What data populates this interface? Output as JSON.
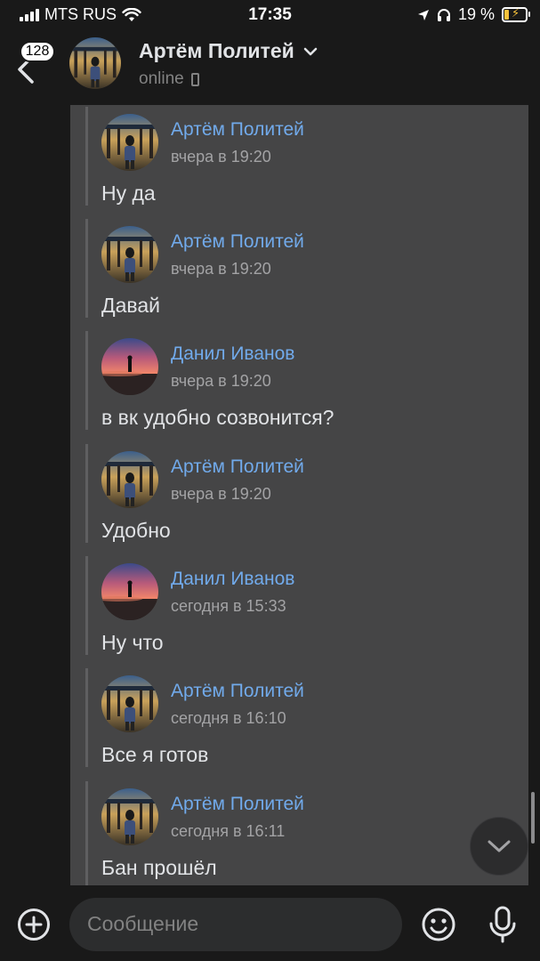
{
  "status_bar": {
    "carrier": "MTS RUS",
    "time": "17:35",
    "battery": "19 %"
  },
  "header": {
    "unread_count": "128",
    "name": "Артём Политей",
    "status": "online"
  },
  "messages": [
    {
      "author": "Артём Политей",
      "time": "вчера в 19:20",
      "text": "Ну да",
      "avatar": "artem-avatar"
    },
    {
      "author": "Артём Политей",
      "time": "вчера в 19:20",
      "text": "Давай",
      "avatar": "artem-avatar"
    },
    {
      "author": "Данил Иванов",
      "time": "вчера в 19:20",
      "text": "в вк удобно созвонится?",
      "avatar": "danil-avatar"
    },
    {
      "author": "Артём Политей",
      "time": "вчера в 19:20",
      "text": "Удобно",
      "avatar": "artem-avatar"
    },
    {
      "author": "Данил Иванов",
      "time": "сегодня в 15:33",
      "text": "Ну что",
      "avatar": "danil-avatar"
    },
    {
      "author": "Артём Политей",
      "time": "сегодня в 16:10",
      "text": "Все я готов",
      "avatar": "artem-avatar"
    },
    {
      "author": "Артём Политей",
      "time": "сегодня в 16:11",
      "text": "Бан прошёл",
      "avatar": "artem-avatar"
    }
  ],
  "composer": {
    "placeholder": "Сообщение"
  },
  "colors": {
    "background": "#191919",
    "card": "#454546",
    "author_link": "#71aaeb",
    "badge": "#ffffff"
  }
}
